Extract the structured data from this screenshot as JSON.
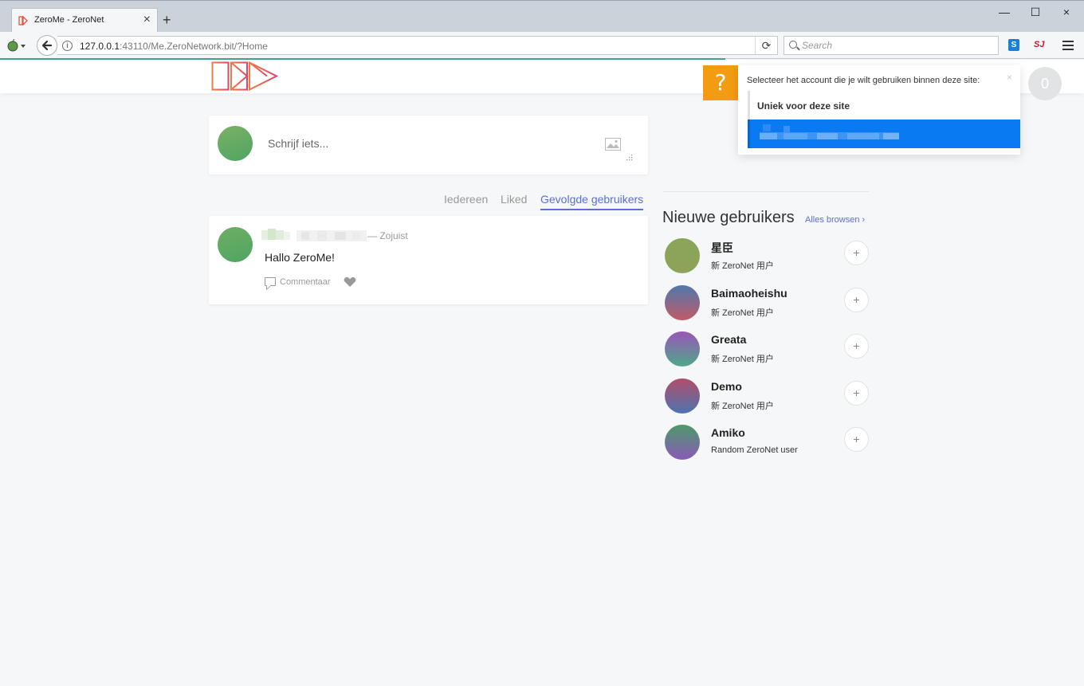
{
  "browser": {
    "tab_title": "ZeroMe - ZeroNet",
    "url_host": "127.0.0.1",
    "url_rest": ":43110/Me.ZeroNetwork.bit/?Home",
    "search_placeholder": "Search",
    "ext_s_label": "S",
    "ext_sj_label": "SJ"
  },
  "header": {
    "notification_count": "0"
  },
  "compose": {
    "placeholder": "Schrijf iets..."
  },
  "filters": [
    {
      "label": "Iedereen",
      "active": false
    },
    {
      "label": "Liked",
      "active": false
    },
    {
      "label": "Gevolgde gebruikers",
      "active": true
    }
  ],
  "post": {
    "time": "— Zojuist",
    "body": "Hallo ZeroMe!",
    "comment_label": "Commentaar"
  },
  "sidebar": {
    "title": "Nieuwe gebruikers",
    "browse_all": "Alles browsen ›",
    "users": [
      {
        "name": "星臣",
        "desc": "新 ZeroNet 用户"
      },
      {
        "name": "Baimaoheishu",
        "desc": "新 ZeroNet 用户"
      },
      {
        "name": "Greata",
        "desc": "新 ZeroNet 用户"
      },
      {
        "name": "Demo",
        "desc": "新 ZeroNet 用户"
      },
      {
        "name": "Amiko",
        "desc": "Random ZeroNet user"
      }
    ]
  },
  "account_popup": {
    "help_label": "?",
    "prompt": "Selecteer het account die je wilt gebruiken binnen deze site:",
    "close_label": "×",
    "option_unique": "Uniek voor deze site"
  },
  "colors": {
    "accent": "#5a6fd8",
    "selected_option": "#0a7af2",
    "help_badge": "#f39c12",
    "loading_bar": "#35a88a"
  }
}
